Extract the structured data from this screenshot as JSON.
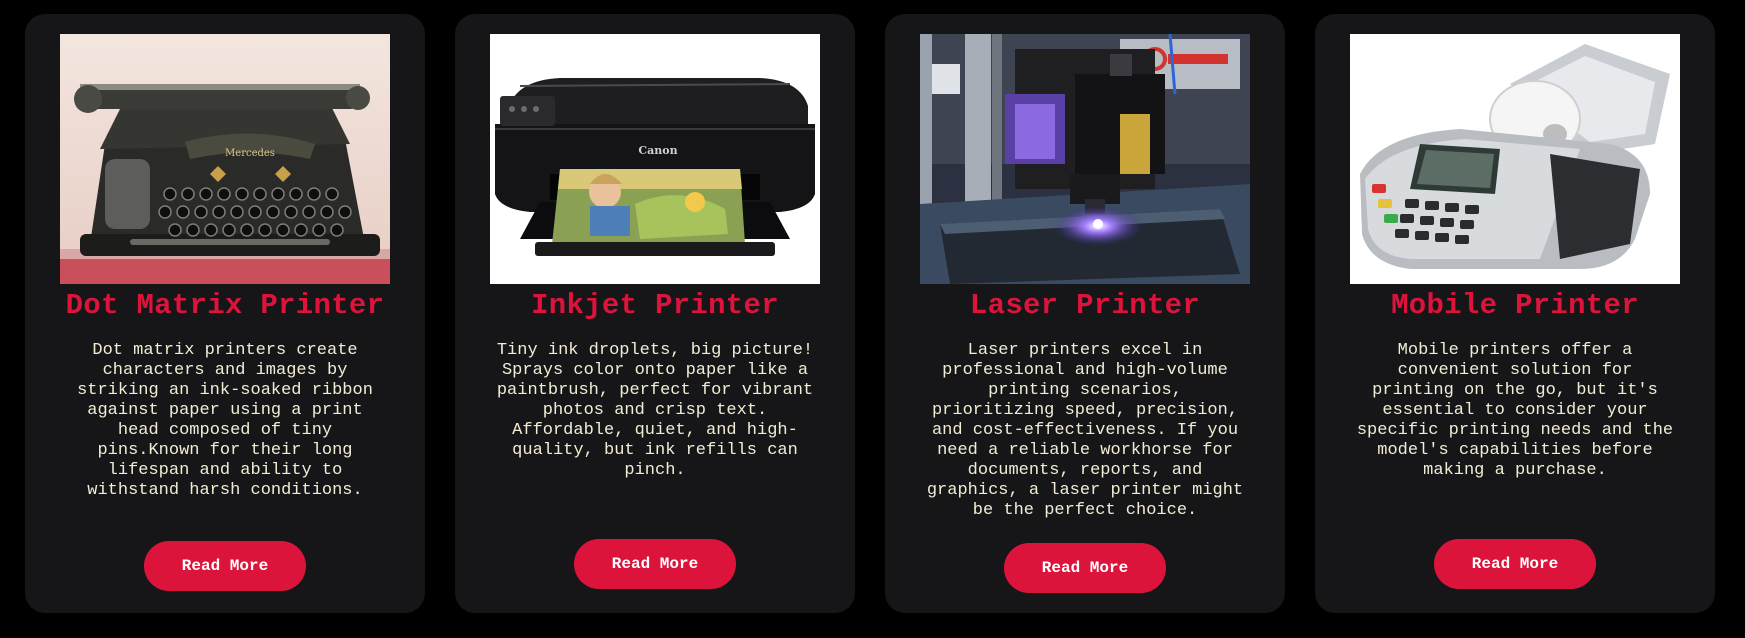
{
  "colors": {
    "page_background": "#000000",
    "card_background": "#161618",
    "accent": "#dc143c",
    "description_text": "#f2ecd4",
    "button_text": "#ffffff"
  },
  "cards": [
    {
      "title": "Dot Matrix Printer",
      "description": "Dot matrix printers create characters and images by striking an ink-soaked ribbon against paper using a print head composed of tiny pins.Known for their long lifespan and ability to withstand harsh conditions.",
      "button_label": "Read More",
      "image": "typewriter-photo"
    },
    {
      "title": "Inkjet Printer",
      "description": "Tiny ink droplets, big picture! Sprays color onto paper like a paintbrush, perfect for vibrant photos and crisp text. Affordable, quiet, and high-quality, but ink refills can pinch.",
      "button_label": "Read More",
      "image": "inkjet-printer-photo",
      "image_brand_text": "Canon"
    },
    {
      "title": "Laser Printer",
      "description": "Laser printers excel in professional and high-volume printing scenarios, prioritizing speed, precision, and cost-effectiveness. If you need a reliable workhorse for documents, reports, and graphics, a laser printer might be the perfect choice.",
      "button_label": "Read More",
      "image": "laser-engraver-photo"
    },
    {
      "title": "Mobile Printer",
      "description": "Mobile printers offer a convenient solution for printing on the go, but it's essential to consider your specific printing needs and the model's capabilities before making a purchase.",
      "button_label": "Read More",
      "image": "mobile-receipt-printer-photo"
    }
  ]
}
